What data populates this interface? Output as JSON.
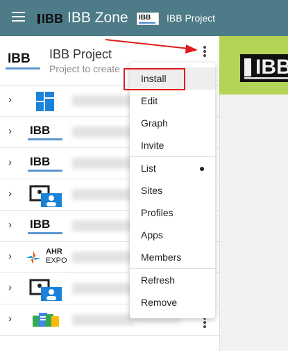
{
  "topbar": {
    "app_logo_text": "IBB",
    "app_title": "IBB Zone",
    "project_logo_text": "IBB",
    "project_title": "IBB Project"
  },
  "project_panel": {
    "logo_text": "IBB",
    "name": "IBB Project",
    "description": "Project to create"
  },
  "rows": [
    {
      "icon": "grid-tiles-icon"
    },
    {
      "icon": "ibb-logo",
      "logo_text": "IBB"
    },
    {
      "icon": "ibb-logo",
      "logo_text": "IBB"
    },
    {
      "icon": "photo-user-icon"
    },
    {
      "icon": "ibb-logo",
      "logo_text": "IBB"
    },
    {
      "icon": "ahr-expo-logo",
      "logo_text": "AHR",
      "logo_subtext": "EXPO"
    },
    {
      "icon": "photo-user-icon"
    },
    {
      "icon": "office-docs-icon"
    }
  ],
  "right_logo_text": "IBB",
  "menu": {
    "items": [
      "Install",
      "Edit",
      "Graph",
      "Invite",
      "List",
      "Sites",
      "Profiles",
      "Apps",
      "Members",
      "Refresh",
      "Remove"
    ],
    "highlighted": "Install",
    "checked": "List"
  },
  "colors": {
    "appbar": "#4d7b87",
    "accent_green": "#b3d455",
    "annotation_red": "#e21a1a"
  }
}
